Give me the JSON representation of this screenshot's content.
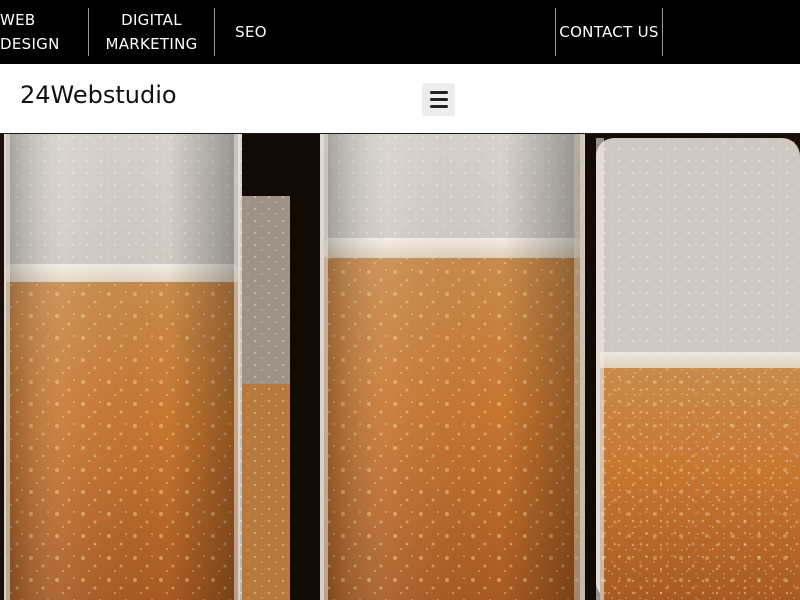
{
  "topnav": {
    "web_design": "WEB\nDESIGN",
    "digital_marketing": "DIGITAL\nMARKETING",
    "seo": "SEO",
    "contact_us": "CONTACT US"
  },
  "header": {
    "brand": "24Webstudio",
    "menu_icon": "hamburger-menu-icon"
  },
  "hero": {
    "image": "glasses-of-sparkling-beer-photo"
  },
  "colors": {
    "topbar_bg": "#000000",
    "topbar_text": "#ffffff",
    "header_bg": "#ffffff",
    "brand_text": "#111111",
    "toggle_bg": "#ededed",
    "beer": "#c9752e"
  }
}
